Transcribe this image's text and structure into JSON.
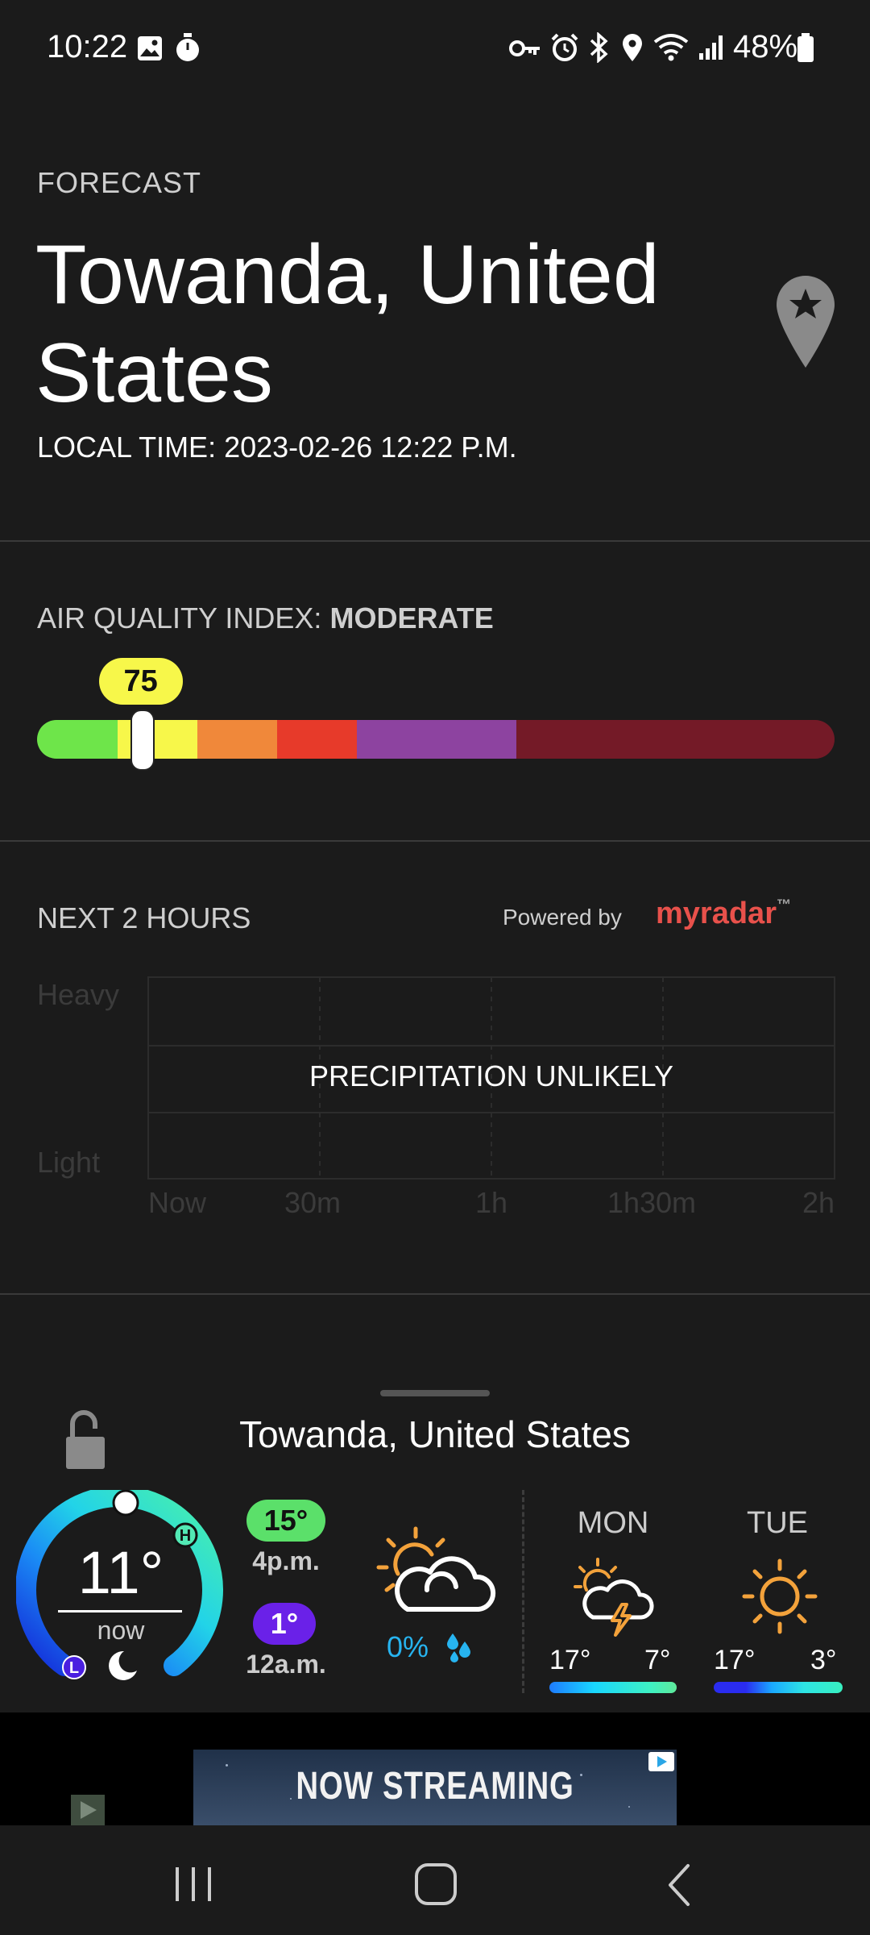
{
  "status_bar": {
    "time": "10:22",
    "battery_percent": "48%",
    "left_icons": [
      "gallery-icon",
      "timer-icon"
    ],
    "right_icons": [
      "vpn-key-icon",
      "alarm-icon",
      "bluetooth-icon",
      "location-icon",
      "wifi-icon",
      "signal-icon",
      "battery-icon"
    ]
  },
  "header": {
    "eyebrow": "FORECAST",
    "city": "Towanda, United States",
    "local_time": "LOCAL TIME: 2023-02-26 12:22 P.M.",
    "favorite_icon": "location-pin-star-icon"
  },
  "aqi": {
    "label": "AIR QUALITY INDEX:",
    "category": "MODERATE",
    "value": "75",
    "value_fraction": 0.13,
    "scale_colors": [
      "#6ee54a",
      "#f7f74a",
      "#f0883a",
      "#e73a2a",
      "#8d43a0",
      "#741a27"
    ]
  },
  "nowcast": {
    "label": "NEXT 2 HOURS",
    "powered_by": "Powered by",
    "brand": "myradar",
    "y_labels": [
      "Heavy",
      "Light"
    ],
    "x_labels": [
      "Now",
      "30m",
      "1h",
      "1h30m",
      "2h"
    ],
    "message": "PRECIPITATION UNLIKELY"
  },
  "widget": {
    "city": "Towanda, United States",
    "current_temp": "11°",
    "now_label": "now",
    "high": {
      "temp": "15°",
      "time": "4p.m."
    },
    "low": {
      "temp": "1°",
      "time": "12a.m."
    },
    "gauge_markers": {
      "high": "H",
      "low": "L"
    },
    "today": {
      "icon": "partly-cloudy-icon",
      "precip": "0%"
    },
    "days": [
      {
        "name": "MON",
        "icon": "thunderstorm-icon",
        "high": "17°",
        "low": "7°"
      },
      {
        "name": "TUE",
        "icon": "sun-icon",
        "high": "17°",
        "low": "3°"
      }
    ]
  },
  "ad": {
    "text": "NOW STREAMING"
  },
  "nav_bar": {
    "buttons": [
      "recents-icon",
      "home-icon",
      "back-icon"
    ]
  }
}
